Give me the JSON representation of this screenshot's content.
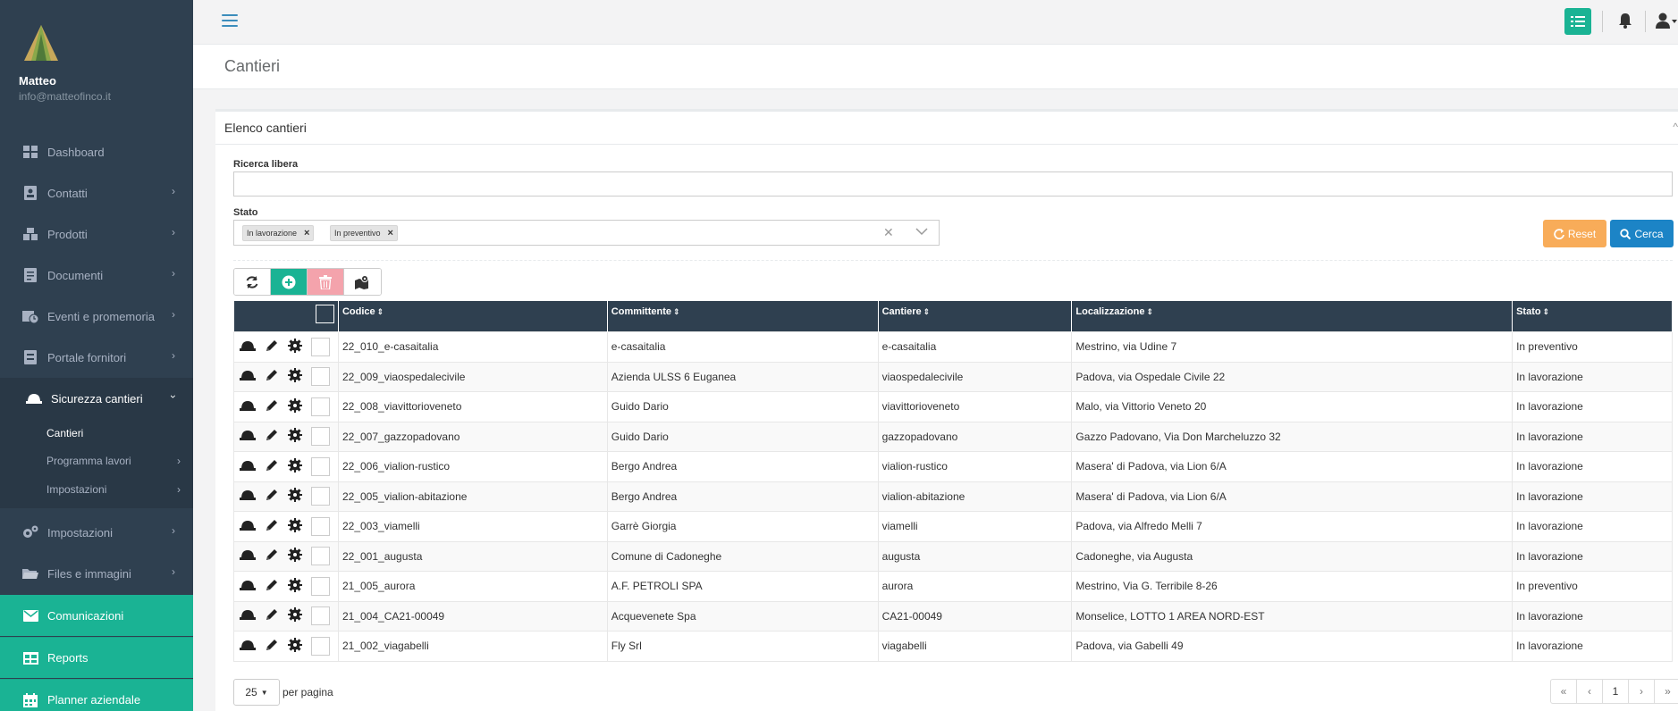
{
  "user": {
    "name": "Matteo",
    "email": "info@matteofinco.it"
  },
  "sidebar": {
    "items": [
      {
        "label": "Dashboard",
        "icon": "dashboard-icon"
      },
      {
        "label": "Contatti",
        "icon": "contacts-icon"
      },
      {
        "label": "Prodotti",
        "icon": "products-icon"
      },
      {
        "label": "Documenti",
        "icon": "documents-icon"
      },
      {
        "label": "Eventi e promemoria",
        "icon": "calendar-clock-icon"
      },
      {
        "label": "Portale fornitori",
        "icon": "portal-icon"
      },
      {
        "label": "Sicurezza cantieri",
        "icon": "helmet-icon"
      },
      {
        "label": "Impostazioni",
        "icon": "gears-icon"
      },
      {
        "label": "Files e immagini",
        "icon": "folder-icon"
      },
      {
        "label": "Comunicazioni",
        "icon": "envelope-icon"
      },
      {
        "label": "Reports",
        "icon": "table-icon"
      },
      {
        "label": "Planner aziendale",
        "icon": "calendar-icon"
      }
    ],
    "sub": [
      {
        "label": "Cantieri"
      },
      {
        "label": "Programma lavori"
      },
      {
        "label": "Impostazioni"
      }
    ]
  },
  "page": {
    "title": "Cantieri"
  },
  "panel": {
    "title": "Elenco cantieri"
  },
  "filters": {
    "search_label": "Ricerca libera",
    "search_value": "",
    "stato_label": "Stato",
    "tags": [
      "In lavorazione",
      "In preventivo"
    ],
    "reset_label": "Reset",
    "cerca_label": "Cerca"
  },
  "table": {
    "headers": [
      "Codice",
      "Committente",
      "Cantiere",
      "Localizzazione",
      "Stato"
    ],
    "rows": [
      [
        "22_010_e-casaitalia",
        "e-casaitalia",
        "e-casaitalia",
        "Mestrino, via Udine 7",
        "In preventivo"
      ],
      [
        "22_009_viaospedalecivile",
        "Azienda ULSS 6 Euganea",
        "viaospedalecivile",
        "Padova, via Ospedale Civile 22",
        "In lavorazione"
      ],
      [
        "22_008_viavittorioveneto",
        "Guido Dario",
        "viavittorioveneto",
        "Malo, via Vittorio Veneto 20",
        "In lavorazione"
      ],
      [
        "22_007_gazzopadovano",
        "Guido Dario",
        "gazzopadovano",
        "Gazzo Padovano, Via Don Marcheluzzo 32",
        "In lavorazione"
      ],
      [
        "22_006_vialion-rustico",
        "Bergo Andrea",
        "vialion-rustico",
        "Masera' di Padova, via Lion 6/A",
        "In lavorazione"
      ],
      [
        "22_005_vialion-abitazione",
        "Bergo Andrea",
        "vialion-abitazione",
        "Masera' di Padova, via Lion 6/A",
        "In lavorazione"
      ],
      [
        "22_003_viamelli",
        "Garrè Giorgia",
        "viamelli",
        "Padova, via Alfredo Melli 7",
        "In lavorazione"
      ],
      [
        "22_001_augusta",
        "Comune di Cadoneghe",
        "augusta",
        "Cadoneghe, via Augusta",
        "In lavorazione"
      ],
      [
        "21_005_aurora",
        "A.F. PETROLI SPA",
        "aurora",
        "Mestrino, Via G. Terribile 8-26",
        "In preventivo"
      ],
      [
        "21_004_CA21-00049",
        "Acquevenete Spa",
        "CA21-00049",
        "Monselice, LOTTO 1 AREA NORD-EST",
        "In lavorazione"
      ],
      [
        "21_002_viagabelli",
        "Fly Srl",
        "viagabelli",
        "Padova, via Gabelli 49",
        "In lavorazione"
      ]
    ]
  },
  "pager": {
    "size": "25",
    "label": "per pagina",
    "pages": [
      "«",
      "‹",
      "1",
      "›",
      "»"
    ]
  },
  "colors": {
    "sidebar": "#2f4050",
    "green": "#1ab394",
    "orange": "#f8ac59",
    "blue": "#1c84c6"
  }
}
